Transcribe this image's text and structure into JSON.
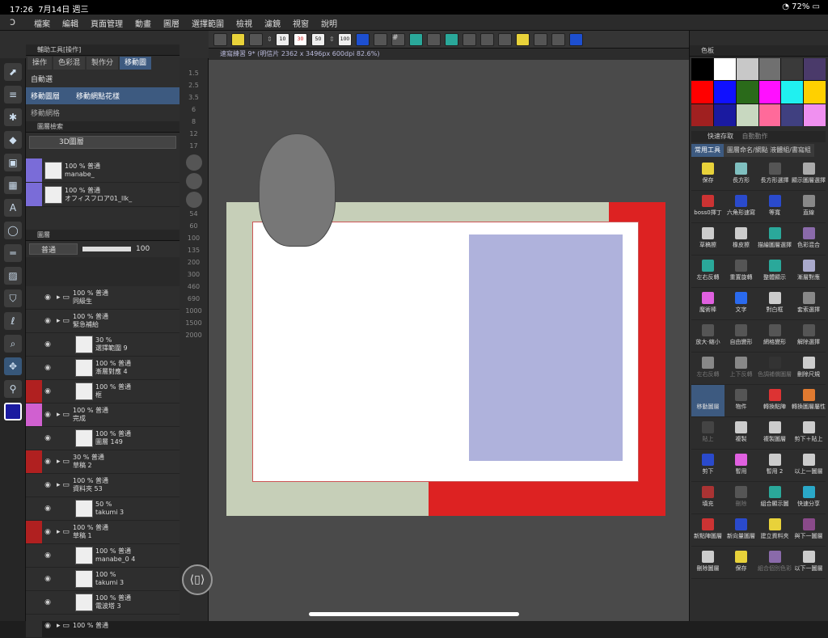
{
  "status": {
    "time": "17:26",
    "date": "7月14日 週三",
    "battery": "72%"
  },
  "menu": [
    "檔案",
    "編輯",
    "頁面管理",
    "動畫",
    "圖層",
    "選擇範圍",
    "檢視",
    "濾鏡",
    "視窗",
    "說明"
  ],
  "subtool": {
    "header": "輔助工具[操作]",
    "tabs": [
      "操作",
      "色彩混",
      "製作分",
      "移動圖"
    ],
    "items": [
      "自動選",
      "移動圖層",
      "移動網點花樣",
      "移動網格"
    ]
  },
  "layer_search": {
    "header": "圖層檢索",
    "filter": "3D圖層",
    "rows": [
      {
        "pct": "100 %",
        "blend": "普通",
        "name": "manabe_"
      },
      {
        "pct": "100 %",
        "blend": "普通",
        "name": "オフィスフロア01_llk_"
      }
    ]
  },
  "layer_panel": {
    "header": "圖層",
    "blend": "普通",
    "opacity": "100",
    "rows": [
      {
        "pct": "100 %",
        "blend": "普通",
        "name": "同級生",
        "type": "folder"
      },
      {
        "pct": "100 %",
        "blend": "普通",
        "name": "緊急補給",
        "type": "folder"
      },
      {
        "pct": "30 %",
        "blend": "",
        "name": "選擇範圍 9",
        "type": "mask"
      },
      {
        "pct": "100 %",
        "blend": "普通",
        "name": "漸層對應 4",
        "type": "layer"
      },
      {
        "pct": "100 %",
        "blend": "普通",
        "name": "框",
        "type": "layer"
      },
      {
        "pct": "100 %",
        "blend": "普通",
        "name": "完成",
        "type": "folder"
      },
      {
        "pct": "100 %",
        "blend": "普通",
        "name": "圖層 149",
        "type": "layer"
      },
      {
        "pct": "30 %",
        "blend": "普通",
        "name": "草稿 2",
        "type": "folder"
      },
      {
        "pct": "100 %",
        "blend": "普通",
        "name": "資料夾 53",
        "type": "folder"
      },
      {
        "pct": "50 %",
        "blend": "",
        "name": "takumi 3",
        "type": "layer"
      },
      {
        "pct": "100 %",
        "blend": "普通",
        "name": "草稿 1",
        "type": "folder"
      },
      {
        "pct": "100 %",
        "blend": "普通",
        "name": "manabe_0 4",
        "type": "layer"
      },
      {
        "pct": "100 %",
        "blend": "",
        "name": "takumi 3",
        "type": "layer"
      },
      {
        "pct": "100 %",
        "blend": "普通",
        "name": "電波塔 3",
        "type": "layer"
      },
      {
        "pct": "100 %",
        "blend": "普通",
        "name": "",
        "type": "folder"
      }
    ]
  },
  "navigator": {
    "zoom_top": [
      "1.5",
      "2.5",
      "3.5",
      "6",
      "8",
      "12",
      "17"
    ],
    "zoom_bottom": [
      "54",
      "60",
      "100",
      "135",
      "200",
      "300",
      "460",
      "690",
      "1000",
      "1500",
      "2000"
    ]
  },
  "canvas": {
    "doc_tab": "速寫練習 9* (明信片 2362 x 3496px 600dpi 82.6%)"
  },
  "color_panel": {
    "header": "色板",
    "colors": [
      "#000000",
      "#ffffff",
      "#c8c8c8",
      "#707070",
      "#3a3a3a",
      "#4a3a6a",
      "#ff0000",
      "#1010ff",
      "#2a6a1a",
      "#ff10ff",
      "#20f0f0",
      "#ffd000",
      "#a02020",
      "#1a1aa0",
      "#c8d8c0",
      "#ff6a9a",
      "#404080",
      "#f090f0"
    ]
  },
  "quick_access": {
    "header": "快速存取",
    "header2": "自動動作",
    "tabs": [
      "常用工具",
      "圖層命名/網點 液體組/書寫組"
    ],
    "items": [
      {
        "label": "保存",
        "color": "#e8d23a"
      },
      {
        "label": "長方形",
        "color": "#7fbfbf"
      },
      {
        "label": "長方形選擇",
        "color": "#555"
      },
      {
        "label": "顯示圖層選擇",
        "color": "#aaa"
      },
      {
        "label": "boss0擇丁",
        "color": "#c33"
      },
      {
        "label": "六角形速寫",
        "color": "#2a4acc"
      },
      {
        "label": "等寬",
        "color": "#2a4acc"
      },
      {
        "label": "直線",
        "color": "#888"
      },
      {
        "label": "草稿擦",
        "color": "#ccc"
      },
      {
        "label": "橡皮擦",
        "color": "#ccc"
      },
      {
        "label": "描繪圖層選擇",
        "color": "#2aa89a"
      },
      {
        "label": "色彩混合",
        "color": "#8a6aaa"
      },
      {
        "label": "左右反轉",
        "color": "#2aa89a"
      },
      {
        "label": "重置旋轉",
        "color": "#555"
      },
      {
        "label": "整體顯示",
        "color": "#2aa89a"
      },
      {
        "label": "漸層對應",
        "color": "#aac"
      },
      {
        "label": "魔術棒",
        "color": "#e060e0"
      },
      {
        "label": "文字",
        "color": "#2a6aee"
      },
      {
        "label": "對白框",
        "color": "#ccc"
      },
      {
        "label": "套索選擇",
        "color": "#888"
      },
      {
        "label": "放大‧縮小",
        "color": "#555"
      },
      {
        "label": "自由變形",
        "color": "#555"
      },
      {
        "label": "網格變形",
        "color": "#555"
      },
      {
        "label": "解除選擇",
        "color": "#555"
      },
      {
        "label": "左右反轉",
        "color": "#888"
      },
      {
        "label": "上下反轉",
        "color": "#888"
      },
      {
        "label": "色調補償圖層",
        "color": "#333"
      },
      {
        "label": "刪除尺規",
        "color": "#ccc"
      },
      {
        "label": "移動圖層",
        "color": "#3d5a80"
      },
      {
        "label": "物件",
        "color": "#555"
      },
      {
        "label": "轉換點陣",
        "color": "#d33"
      },
      {
        "label": "轉換圖層屬性",
        "color": "#e07a30"
      },
      {
        "label": "貼上",
        "color": "#444"
      },
      {
        "label": "複製",
        "color": "#ccc"
      },
      {
        "label": "複製圖層",
        "color": "#ccc"
      },
      {
        "label": "剪下＋貼上",
        "color": "#ccc"
      },
      {
        "label": "剪下",
        "color": "#2a4acc"
      },
      {
        "label": "暫用",
        "color": "#e060e0"
      },
      {
        "label": "暫用 2",
        "color": "#ccc"
      },
      {
        "label": "以上一圖層",
        "color": "#ccc"
      },
      {
        "label": "填充",
        "color": "#a33"
      },
      {
        "label": "刪除",
        "color": "#555"
      },
      {
        "label": "組合顯示圖",
        "color": "#2aa89a"
      },
      {
        "label": "快速分享",
        "color": "#2aa8c8"
      },
      {
        "label": "新點陣圖層",
        "color": "#c33"
      },
      {
        "label": "新向量圖層",
        "color": "#2a4acc"
      },
      {
        "label": "建立資料夾",
        "color": "#e8d23a"
      },
      {
        "label": "與下一圖層",
        "color": "#8a4a8a"
      },
      {
        "label": "刪除圖層",
        "color": "#ccc"
      },
      {
        "label": "保存",
        "color": "#e8d23a"
      },
      {
        "label": "組合個別色彩",
        "color": "#8a6aaa"
      },
      {
        "label": "以下一圖層",
        "color": "#ccc"
      }
    ]
  }
}
